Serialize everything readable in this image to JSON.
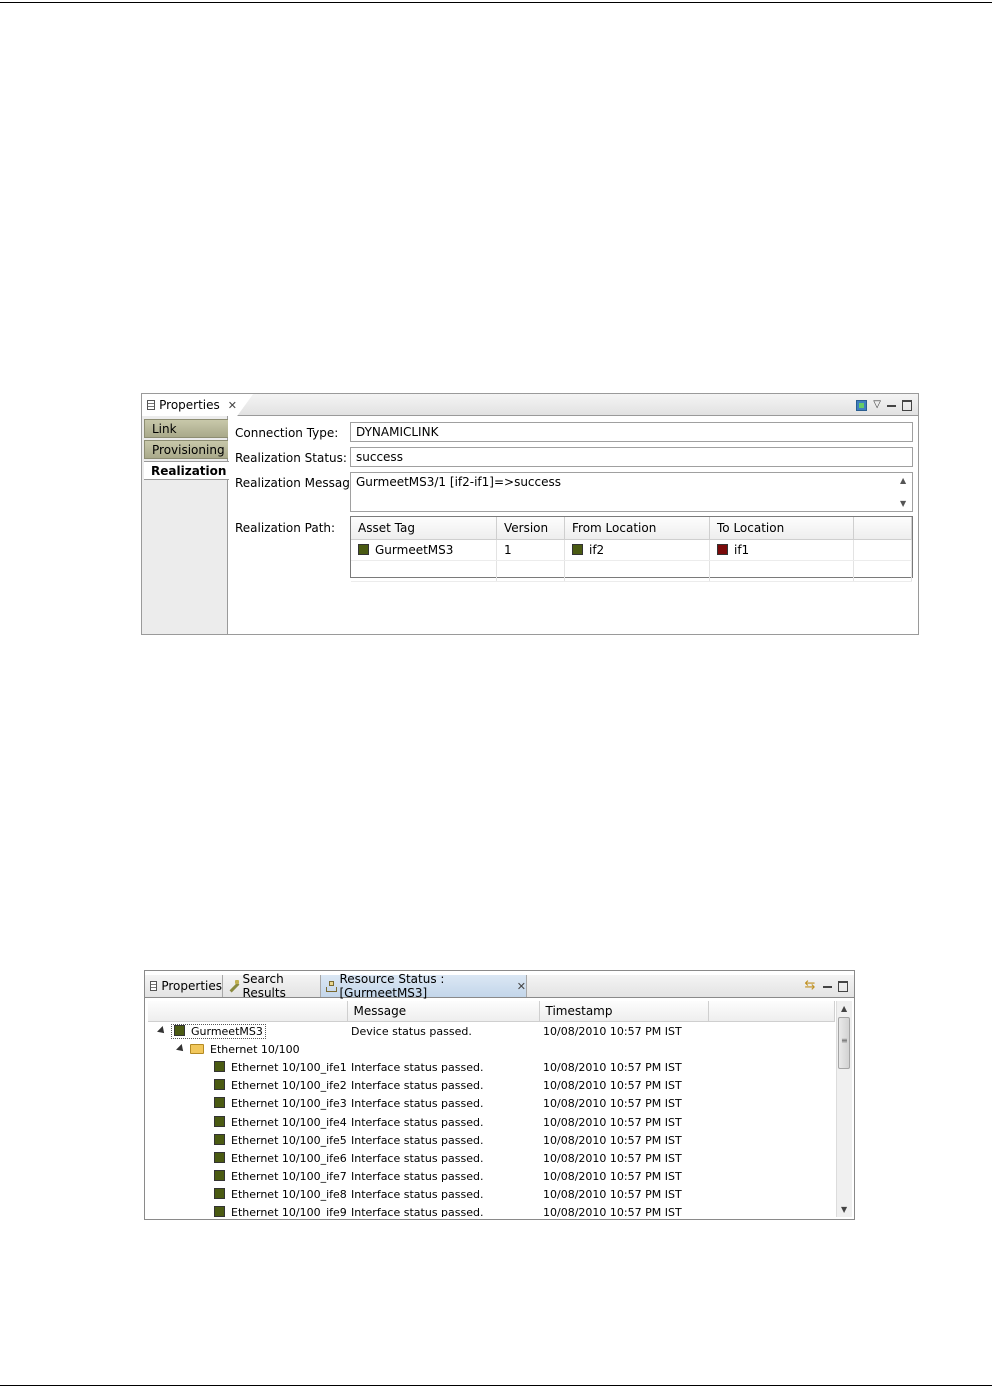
{
  "properties_view": {
    "tab_label": "Properties",
    "sections": [
      {
        "label": "Link",
        "active": false
      },
      {
        "label": "Provisioning",
        "active": false
      },
      {
        "label": "Realization",
        "active": true
      }
    ],
    "fields": {
      "connection_type_label": "Connection Type:",
      "connection_type_value": "DYNAMICLINK",
      "realization_status_label": "Realization Status:",
      "realization_status_value": "success",
      "realization_message_label": "Realization Message:",
      "realization_message_value": "GurmeetMS3/1 [if2-if1]=>success",
      "realization_path_label": "Realization Path:"
    },
    "path_table": {
      "columns": [
        "Asset Tag",
        "Version",
        "From Location",
        "To Location"
      ],
      "rows": [
        {
          "asset_tag": "GurmeetMS3",
          "version": "1",
          "from_location": "if2",
          "to_location": "if1"
        }
      ]
    },
    "colors": {
      "ok_green": "#4a5a12",
      "error_red": "#7a0a0a"
    }
  },
  "resource_status_view": {
    "tabs": [
      {
        "label": "Properties",
        "icon": "properties-icon"
      },
      {
        "label": "Search Results",
        "icon": "search-icon"
      },
      {
        "label": "Resource Status : [GurmeetMS3]",
        "icon": "resource-icon",
        "active": true
      }
    ],
    "columns": [
      "",
      "Message",
      "Timestamp",
      ""
    ],
    "device": {
      "name": "GurmeetMS3",
      "message": "Device status passed.",
      "timestamp": "10/08/2010 10:57 PM IST"
    },
    "group": {
      "name": "Ethernet 10/100"
    },
    "interfaces": [
      {
        "name": "Ethernet 10/100_ife1",
        "message": "Interface status passed.",
        "timestamp": "10/08/2010 10:57 PM IST"
      },
      {
        "name": "Ethernet 10/100_ife2",
        "message": "Interface status passed.",
        "timestamp": "10/08/2010 10:57 PM IST"
      },
      {
        "name": "Ethernet 10/100_ife3",
        "message": "Interface status passed.",
        "timestamp": "10/08/2010 10:57 PM IST"
      },
      {
        "name": "Ethernet 10/100_ife4",
        "message": "Interface status passed.",
        "timestamp": "10/08/2010 10:57 PM IST"
      },
      {
        "name": "Ethernet 10/100_ife5",
        "message": "Interface status passed.",
        "timestamp": "10/08/2010 10:57 PM IST"
      },
      {
        "name": "Ethernet 10/100_ife6",
        "message": "Interface status passed.",
        "timestamp": "10/08/2010 10:57 PM IST"
      },
      {
        "name": "Ethernet 10/100_ife7",
        "message": "Interface status passed.",
        "timestamp": "10/08/2010 10:57 PM IST"
      },
      {
        "name": "Ethernet 10/100_ife8",
        "message": "Interface status passed.",
        "timestamp": "10/08/2010 10:57 PM IST"
      },
      {
        "name": "Ethernet 10/100_ife9",
        "message": "Interface status passed.",
        "timestamp": "10/08/2010 10:57 PM IST"
      }
    ]
  }
}
